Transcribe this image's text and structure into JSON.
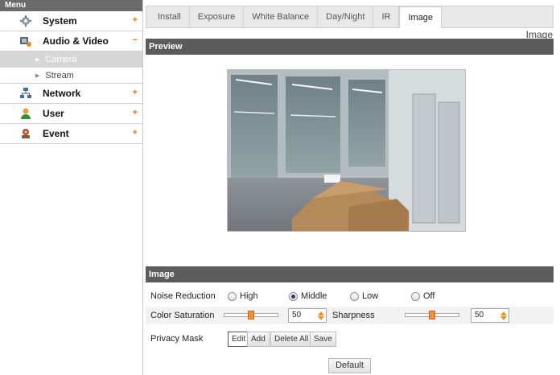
{
  "sidebar": {
    "title": "Menu",
    "items": [
      {
        "label": "System",
        "toggle": "+"
      },
      {
        "label": "Audio & Video",
        "toggle": "−"
      },
      {
        "label": "Network",
        "toggle": "+"
      },
      {
        "label": "User",
        "toggle": "+"
      },
      {
        "label": "Event",
        "toggle": "+"
      }
    ],
    "sub_items": [
      {
        "label": "Camera",
        "active": true
      },
      {
        "label": "Stream",
        "active": false
      }
    ]
  },
  "tabs": [
    {
      "label": "Install"
    },
    {
      "label": "Exposure"
    },
    {
      "label": "White Balance"
    },
    {
      "label": "Day/Night"
    },
    {
      "label": "IR"
    },
    {
      "label": "Image",
      "active": true
    }
  ],
  "page_title": "Image",
  "sections": {
    "preview": "Preview",
    "image": "Image"
  },
  "noise_reduction": {
    "label": "Noise Reduction",
    "options": [
      "High",
      "Middle",
      "Low",
      "Off"
    ],
    "selected": "Middle"
  },
  "color_saturation": {
    "label": "Color Saturation",
    "value": "50"
  },
  "sharpness": {
    "label": "Sharpness",
    "value": "50"
  },
  "privacy_mask": {
    "label": "Privacy Mask",
    "buttons": [
      "Edit",
      "Add",
      "Delete All",
      "Save"
    ]
  },
  "default_button": "Default",
  "colors": {
    "accent": "#e07a1f",
    "section_bar": "#5c5c5c",
    "slider_thumb": "#f0903c"
  }
}
